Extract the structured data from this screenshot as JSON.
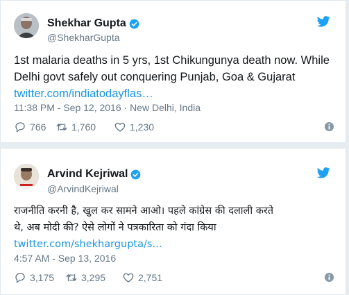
{
  "tweets": [
    {
      "name": "Shekhar Gupta",
      "handle": "@ShekharGupta",
      "text_lines": [
        "1st malaria deaths in 5 yrs, 1st Chikungunya death now. While",
        "Delhi govt safely out conquering Punjab, Goa & Gujarat"
      ],
      "link": "twitter.com/indiatodayflas…",
      "meta": "11:38 PM - Sep 12, 2016 · New Delhi, India",
      "replies": "766",
      "retweets": "1,760",
      "likes": "1,230"
    },
    {
      "name": "Arvind Kejriwal",
      "handle": "@ArvindKejriwal",
      "text_lines": [
        "राजनीति करनी है, खुल कर सामने आओ। पहले कांग्रेस की दलाली करते",
        "थे, अब मोदी की? ऐसे लोगों ने पत्रकारिता को गंदा किया"
      ],
      "link": "twitter.com/shekhargupta/s…",
      "meta": "4:57 AM - Sep 13, 2016",
      "replies": "3,175",
      "retweets": "3,295",
      "likes": "2,751"
    }
  ],
  "colors": {
    "brand": "#1da1f2",
    "link": "#1b95e0",
    "secondary_text": "#657786",
    "background": "#e6ecf0"
  },
  "icons": {
    "verified": "verified-badge-icon",
    "bird": "twitter-bird-icon",
    "reply": "reply-icon",
    "retweet": "retweet-icon",
    "like": "heart-icon",
    "info": "info-icon"
  }
}
